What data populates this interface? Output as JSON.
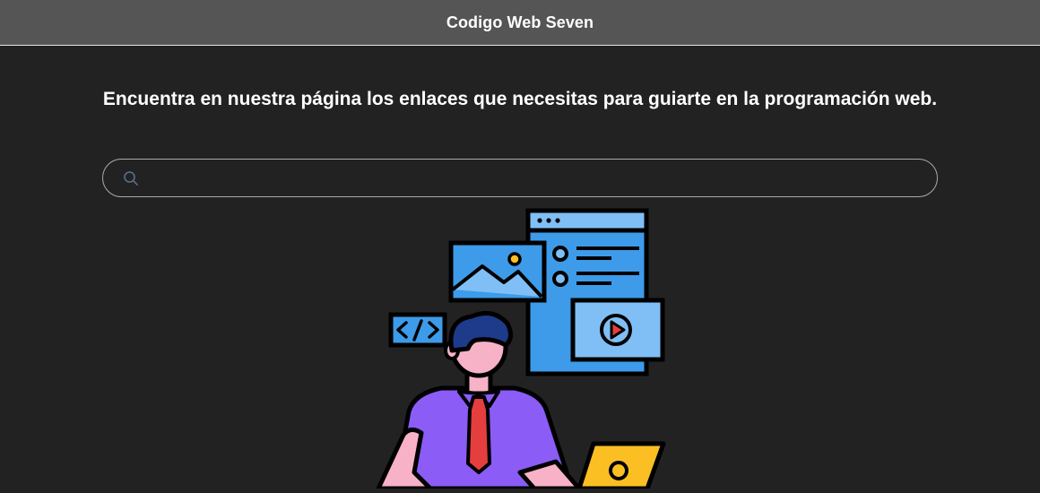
{
  "header": {
    "title": "Codigo Web Seven"
  },
  "main": {
    "tagline": "Encuentra en nuestra página los enlaces que necesitas para guiarte en la programación web.",
    "search": {
      "value": "",
      "placeholder": "",
      "icon": "search-icon"
    },
    "illustration": {
      "code_tag": "</>",
      "icons": [
        "web-developer-illustration",
        "browser-window-icon",
        "image-icon",
        "video-play-icon",
        "code-tag-icon",
        "laptop-icon"
      ]
    }
  },
  "colors": {
    "background": "#222222",
    "header": "#555555",
    "text": "#ffffff",
    "search_border": "#aaaaaa",
    "illustration_blue": "#3d9be9",
    "illustration_light_blue": "#7fbff5",
    "shirt_purple": "#8b5cf6",
    "skin_pink": "#f7b2c8",
    "tie_red": "#e53e3e",
    "hair_navy": "#1e3a8a",
    "laptop_yellow": "#fbbf24"
  }
}
